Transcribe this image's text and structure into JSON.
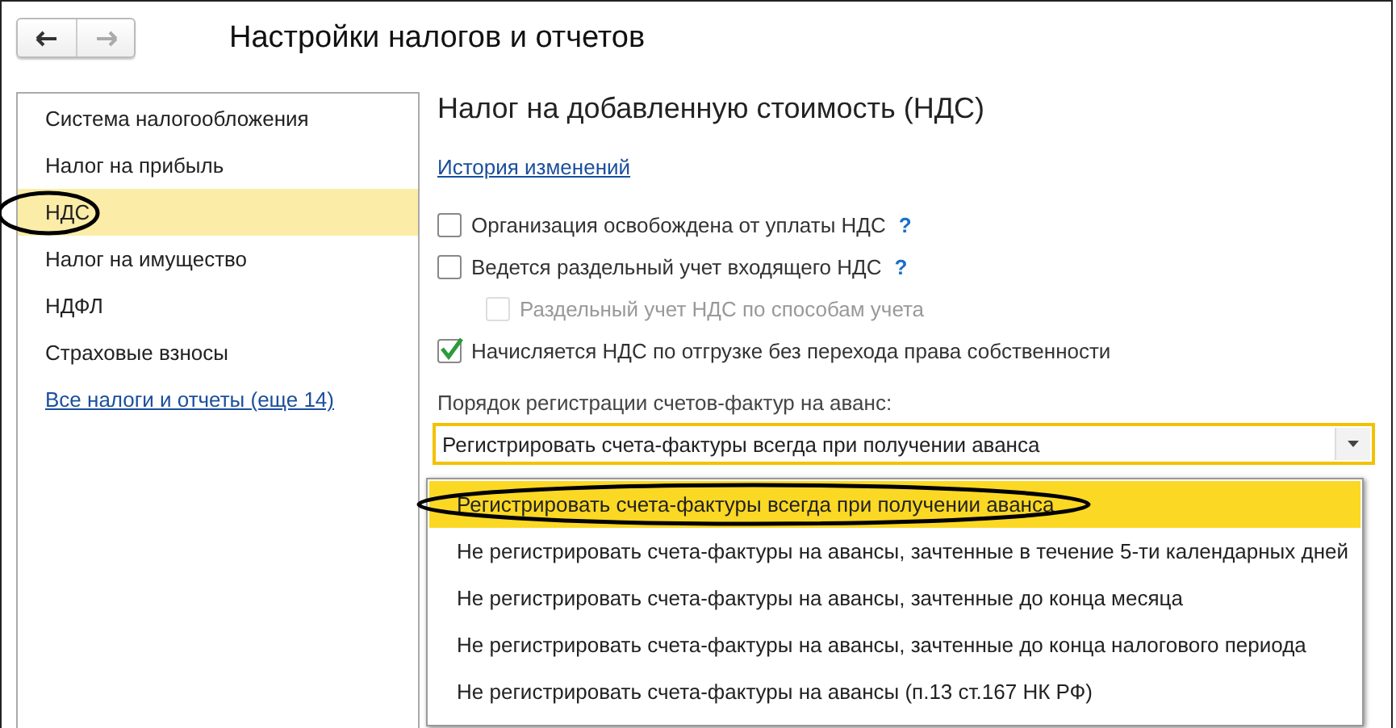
{
  "window": {
    "title": "Настройки налогов и отчетов"
  },
  "nav": [
    {
      "kind": "back",
      "disabled": false
    },
    {
      "kind": "forward",
      "disabled": true
    }
  ],
  "sidebar": {
    "items": [
      {
        "label": "Система налогообложения",
        "selected": false,
        "circled": false
      },
      {
        "label": "Налог на прибыль",
        "selected": false,
        "circled": false
      },
      {
        "label": "НДС",
        "selected": true,
        "circled": true
      },
      {
        "label": "Налог на имущество",
        "selected": false,
        "circled": false
      },
      {
        "label": "НДФЛ",
        "selected": false,
        "circled": false
      },
      {
        "label": "Страховые взносы",
        "selected": false,
        "circled": false
      }
    ],
    "link": "Все налоги и отчеты (еще 14)"
  },
  "content": {
    "heading": "Налог на добавленную стоимость (НДС)",
    "link": "История изменений",
    "options": [
      {
        "label": "Организация освобождена от уплаты НДС",
        "checked": false,
        "disabled": false,
        "help": "?"
      },
      {
        "label": "Ведется раздельный учет входящего НДС",
        "checked": false,
        "disabled": false,
        "help": "?",
        "children": [
          {
            "label": "Раздельный учет НДС по способам учета",
            "checked": false,
            "disabled": true
          }
        ]
      },
      {
        "label": "Начисляется НДС по отгрузке без перехода права собственности",
        "checked": true,
        "disabled": false
      }
    ],
    "select": {
      "label": "Порядок регистрации счетов-фактур на аванс:",
      "value": "Регистрировать счета-фактуры всегда при получении аванса",
      "expanded": true,
      "options": [
        {
          "label": "Регистрировать счета-фактуры всегда при получении аванса",
          "selected": true,
          "circled": true
        },
        {
          "label": "Не регистрировать счета-фактуры на авансы, зачтенные в течение 5-ти календарных дней",
          "selected": false,
          "circled": false
        },
        {
          "label": "Не регистрировать счета-фактуры на авансы, зачтенные до конца месяца",
          "selected": false,
          "circled": false
        },
        {
          "label": "Не регистрировать счета-фактуры на авансы, зачтенные до конца налогового периода",
          "selected": false,
          "circled": false
        },
        {
          "label": "Не регистрировать счета-фактуры на авансы (п.13 ст.167 НК РФ)",
          "selected": false,
          "circled": false
        }
      ]
    }
  }
}
